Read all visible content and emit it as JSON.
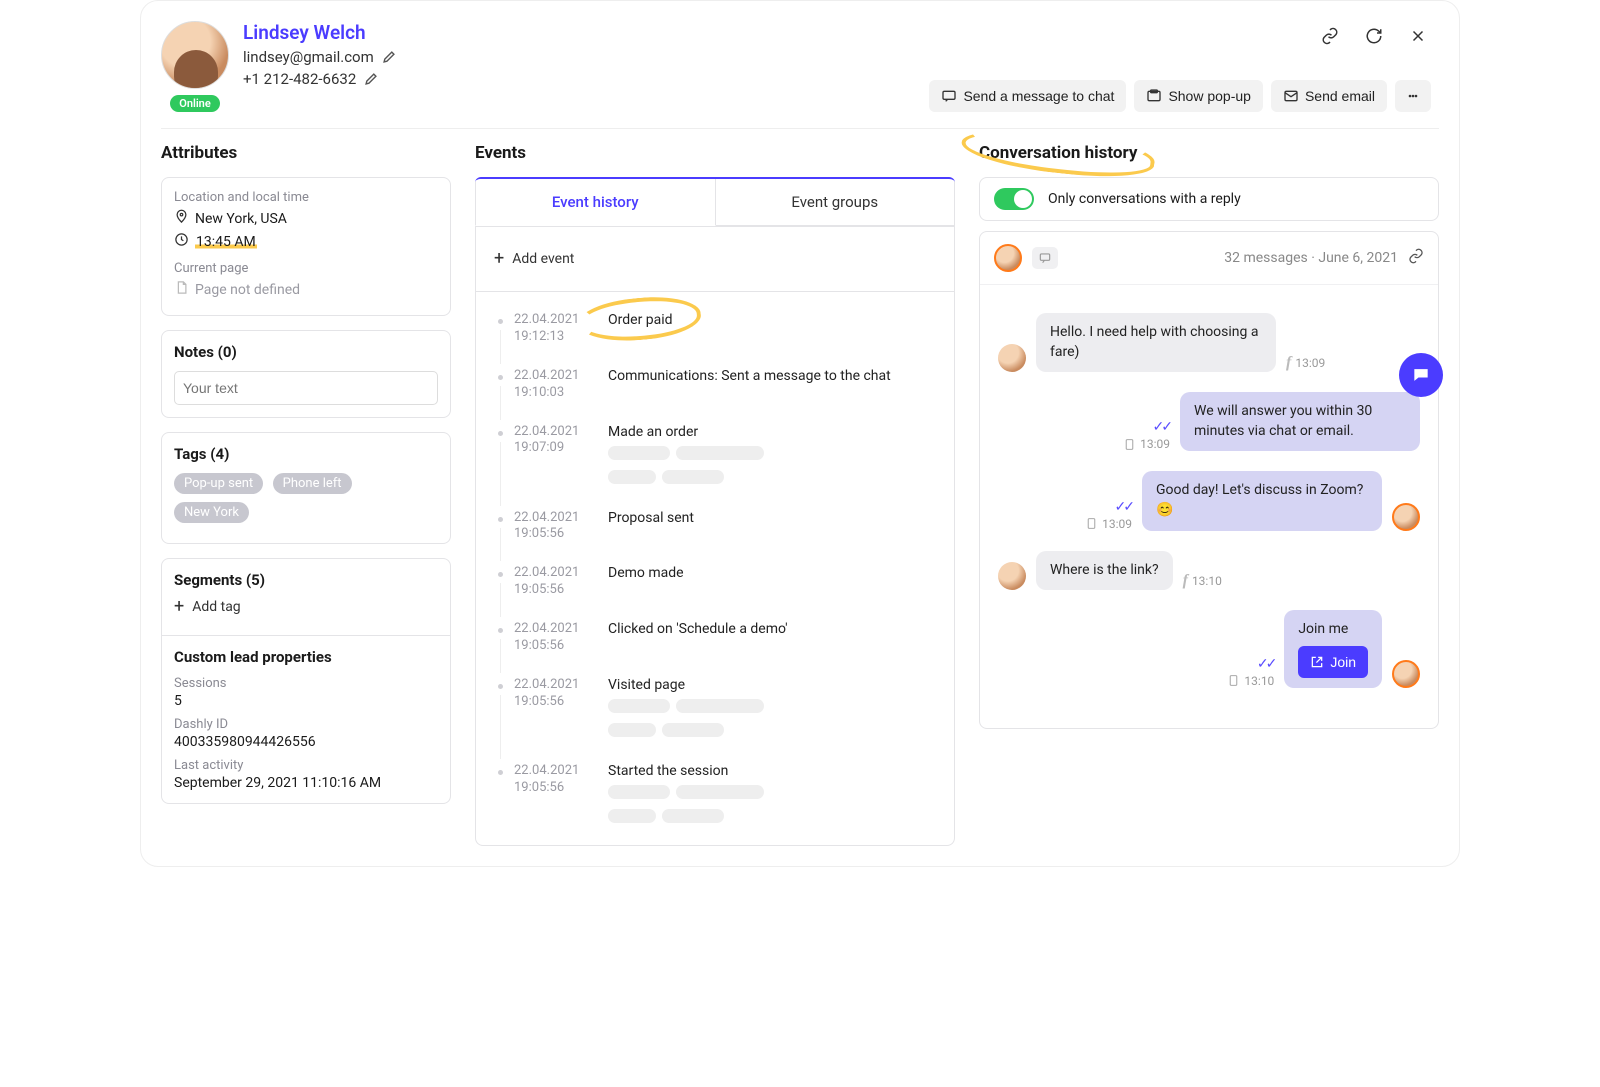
{
  "user": {
    "name": "Lindsey Welch",
    "email": "lindsey@gmail.com",
    "phone": "+1 212-482-6632",
    "status": "Online"
  },
  "header_actions": {
    "send_chat": "Send a message to chat",
    "show_popup": "Show pop-up",
    "send_email": "Send email"
  },
  "attributes": {
    "title": "Attributes",
    "loc_label": "Location and local time",
    "location": "New York, USA",
    "local_time": "13:45 AM",
    "current_page_label": "Current page",
    "current_page_value": "Page not defined"
  },
  "notes": {
    "title": "Notes (0)",
    "placeholder": "Your text"
  },
  "tags": {
    "title": "Tags (4)",
    "list": [
      "Pop-up sent",
      "Phone left",
      "New York"
    ]
  },
  "segments": {
    "title": "Segments (5)",
    "add_tag": "Add tag"
  },
  "custom_lead": {
    "title": "Custom lead properties",
    "sessions_label": "Sessions",
    "sessions_value": "5",
    "dashly_label": "Dashly ID",
    "dashly_value": "400335980944426556",
    "lastact_label": "Last activity",
    "lastact_value": "September 29, 2021 11:10:16 AM"
  },
  "events": {
    "title": "Events",
    "tab_history": "Event history",
    "tab_groups": "Event groups",
    "add_event": "Add event",
    "items": [
      {
        "date": "22.04.2021",
        "time": "19:12:13",
        "text": "Order paid",
        "hl": true
      },
      {
        "date": "22.04.2021",
        "time": "19:10:03",
        "text": "Communications: Sent a message to the chat"
      },
      {
        "date": "22.04.2021",
        "time": "19:07:09",
        "text": "Made an order",
        "skeleton": true
      },
      {
        "date": "22.04.2021",
        "time": "19:05:56",
        "text": "Proposal sent"
      },
      {
        "date": "22.04.2021",
        "time": "19:05:56",
        "text": "Demo made"
      },
      {
        "date": "22.04.2021",
        "time": "19:05:56",
        "text": "Clicked on 'Schedule a demo'"
      },
      {
        "date": "22.04.2021",
        "time": "19:05:56",
        "text": "Visited page",
        "skeleton": true
      },
      {
        "date": "22.04.2021",
        "time": "19:05:56",
        "text": "Started the session",
        "skeleton": true
      }
    ]
  },
  "conversation": {
    "title": "Conversation history",
    "filter_label": "Only conversations with a reply",
    "meta_text": "32 messages · June 6, 2021",
    "messages": {
      "m1": {
        "text": "Hello. I need help with choosing a fare)",
        "time": "13:09"
      },
      "m2": {
        "text": "We will answer you within 30 minutes via chat or email.",
        "time": "13:09"
      },
      "m3": {
        "text": "Good day! Let's discuss in Zoom? 😊",
        "time": "13:09"
      },
      "m4": {
        "text": "Where is the link?",
        "time": "13:10"
      },
      "m5": {
        "text": "Join me",
        "time": "13:10",
        "button": "Join"
      }
    }
  }
}
